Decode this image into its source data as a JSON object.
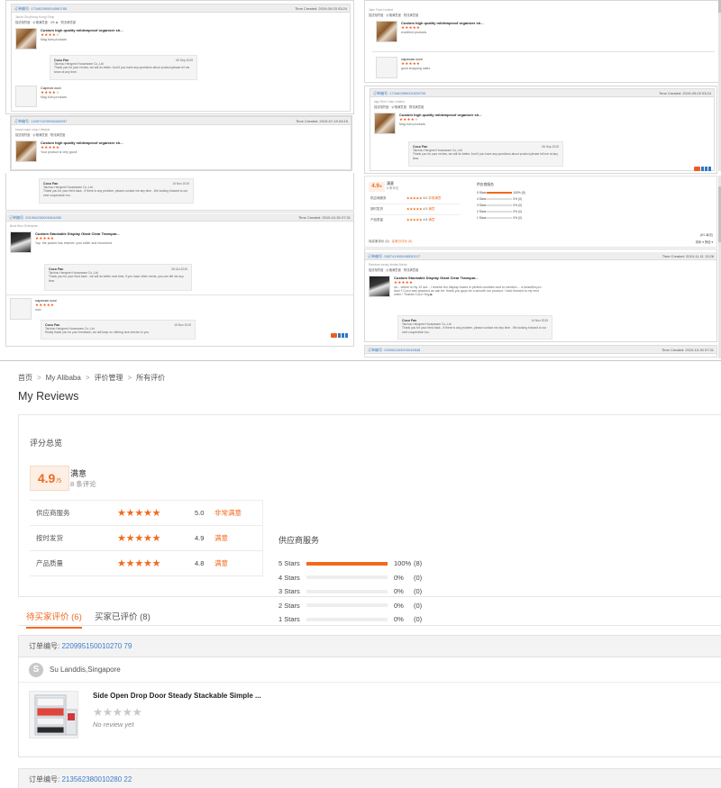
{
  "collage": {
    "tl1": {
      "order": "订单编号: 173462959004580765",
      "time": "Time Created: 2019-09-03 03:24",
      "buyer": "Jacob Guo(Hong Kong) Shop",
      "tabs": "描述相符度 · 价格满意度 · 4/5 ★ · 物流满意度",
      "product": "Custom high quality mildewproof organizer sh...",
      "comment": "Mag bum products",
      "reply_name": "Coco Fan",
      "reply_company": "Taizhou Hengmei Houseware Co.,Ltd",
      "reply_date": "06 Sep 2019",
      "reply_text": "Thank you for your review, we will do better. And if you have any questions about product,please let me know at any time.",
      "buyer2": "Capeon cool",
      "comment2": "Mag bum products"
    },
    "tl2": {
      "order": "订单编号: 134571678950448937",
      "time": "Time Created: 2019-07-19 03:15",
      "buyer": "kawai cajon shop Lifestyle",
      "tabs": "描述相符度 · 价格满意度 · 物流满意度",
      "product": "Custom high quality mildewproof organizer sh...",
      "comment": "Your product is very good!"
    },
    "tl3": {
      "reply_name": "Coco Fan",
      "reply_company": "Taizhou Hengmei Houseware Co.,Ltd",
      "reply_date": "15 Nov 2019",
      "reply_text": "Thank you for your feed back , If there is any problem, please contact me any time . We looking forward to our next cooperation too."
    },
    "tl4": {
      "order": "订单编号: 201906230009404050",
      "time": "Time Created: 2019-10-30 07:31",
      "buyer": "Buck Brez Enterprise",
      "product": "Custom Stackable Display Giant Clear Transpar...",
      "comment": "Yop. the packer has reserve, your seller and recomend",
      "reply_name": "Coco Fan",
      "reply_company": "Taizhou Hengmei Houseware Co.,Ltd",
      "reply_date": "28 Oct 2019",
      "reply_text": "Thank you for your feed back , we will do better next time, if you have other needs, you can tell me any time.",
      "buyer2": "capecan cool",
      "comment2": "nice..",
      "reply2_name": "Coco Fan",
      "reply2_company": "Taizhou Hengmei Houseware Co.,Ltd",
      "reply2_date": "19 Nov 2019",
      "reply2_text": "Really thank you for your feedback, we will keep on offering nice service to you."
    },
    "tr1": {
      "buyer": "Jake Farm Limited",
      "tabs": "描述相符度 · 价格满意度 · 物流满意度",
      "product": "Custom high quality mildewproof organizer sh...",
      "comment": "excellent products",
      "buyer2": "capecan cool",
      "comment2": "good shopping sales"
    },
    "tr2": {
      "order": "订单编号: 173462959001928793",
      "time": "Time Created: 2019-09-03 03:24",
      "buyer": "kajo Rice Cake Limited",
      "tabs": "描述相符度 · 价格满意度 · 物流满意度",
      "product": "Custom high quality mildewproof organizer sh...",
      "comment": "Mag bum products",
      "reply_name": "Coco Fan",
      "reply_company": "Taizhou Hengmei Houseware Co.,Ltd",
      "reply_date": "06 Sep 2019",
      "reply_text": "Thank you for your review, we will do better. And if you have any questions about product,please tell me at any time."
    },
    "tr3": {
      "score": "4.9",
      "score_suffix": "/5",
      "label": "满意",
      "count": "8 条评论",
      "rows": [
        {
          "label": "供应商服务",
          "value": "5.0",
          "text": "非常满意"
        },
        {
          "label": "按时发货",
          "value": "4.9",
          "text": "满意"
        },
        {
          "label": "产品质量",
          "value": "4.8",
          "text": "满意"
        }
      ],
      "dist_title": "供应商服务",
      "dist": [
        {
          "label": "5 Stars",
          "pct": "100%",
          "count": "(8)"
        },
        {
          "label": "4 Stars",
          "pct": "0%",
          "count": "(0)"
        },
        {
          "label": "3 Stars",
          "pct": "0%",
          "count": "(0)"
        },
        {
          "label": "2 Stars",
          "pct": "0%",
          "count": "(0)"
        },
        {
          "label": "1 Stars",
          "pct": "0%",
          "count": "(0)"
        }
      ],
      "tab_a": "待买家评价 (0)",
      "tab_b": "买家已评价 (8)",
      "pager": "(8/1 每页)",
      "sort": "排序 ▾ 筛选 ▾"
    },
    "tr4": {
      "order": "订单编号: 280741905948530217",
      "time": "Time Created: 2019-11-11 13:26",
      "buyer": "Rainbow trendy limited Mexic",
      "tabs": "描述相符度 · 价格满意度 · 物流满意度",
      "product": "Custom Stackable Display Giant Clear Transpar...",
      "comment": "ok... where is my 10 dot... I receive ten display boxes in perfect condition and to mention ... a beautiful pro duct !! Coco was gracious as can be. thank you guys for a smooth run product. I look forward to my next order ! Thanks Coco Ying ▶",
      "reply_name": "Coco Fan",
      "reply_company": "Taizhou Hengmei Houseware Co.,Ltd",
      "reply_date": "14 Nov 2019",
      "reply_text": "Thank you for your feed back , If there is any problem, please contact me any time . We looking forward to our next cooperation too."
    },
    "tr5": {
      "order": "订单编号: 205082263000049848",
      "time": "Time Created: 2019-10-30 07:31"
    }
  },
  "breadcrumb": {
    "items": [
      "首页",
      "My Alibaba",
      "评价管理",
      "所有评价"
    ]
  },
  "page_title": "My Reviews",
  "summary": {
    "title": "评分总览",
    "score": "4.9",
    "score_suffix": "/5",
    "label": "满意",
    "count": "8 条评论",
    "rows": [
      {
        "label": "供应商服务",
        "stars": "★★★★★",
        "value": "5.0",
        "text": "非常满意"
      },
      {
        "label": "按时发货",
        "stars": "★★★★★",
        "value": "4.9",
        "text": "满意"
      },
      {
        "label": "产品质量",
        "stars": "★★★★★",
        "value": "4.8",
        "text": "满意"
      }
    ],
    "dist_title": "供应商服务",
    "dist": [
      {
        "label": "5 Stars",
        "fraction": 1.0,
        "pct": "100%",
        "count": "(8)"
      },
      {
        "label": "4 Stars",
        "fraction": 0,
        "pct": "0%",
        "count": "(0)"
      },
      {
        "label": "3 Stars",
        "fraction": 0,
        "pct": "0%",
        "count": "(0)"
      },
      {
        "label": "2 Stars",
        "fraction": 0,
        "pct": "0%",
        "count": "(0)"
      },
      {
        "label": "1 Stars",
        "fraction": 0,
        "pct": "0%",
        "count": "(0)"
      }
    ]
  },
  "tabs": {
    "pending": "待买家评价 (6)",
    "done": "买家已评价 (8)"
  },
  "orders": [
    {
      "label": "订单编号:",
      "number": "220995150010270 79",
      "buyer_initial": "S",
      "buyer": "Su Landdis,Singapore",
      "product": "Side Open Drop Door Steady Stackable Simple ...",
      "stars": "★★★★★",
      "status": "No review yet"
    },
    {
      "label": "订单编号:",
      "number": "213562380010280 22"
    }
  ],
  "colors": {
    "accent": "#ef6a22",
    "link": "#3a7dc9",
    "star_empty": "#c9c9c9"
  },
  "icons": [
    "chevron-right-icon",
    "star-icon",
    "avatar-icon",
    "shoe-box-image"
  ]
}
